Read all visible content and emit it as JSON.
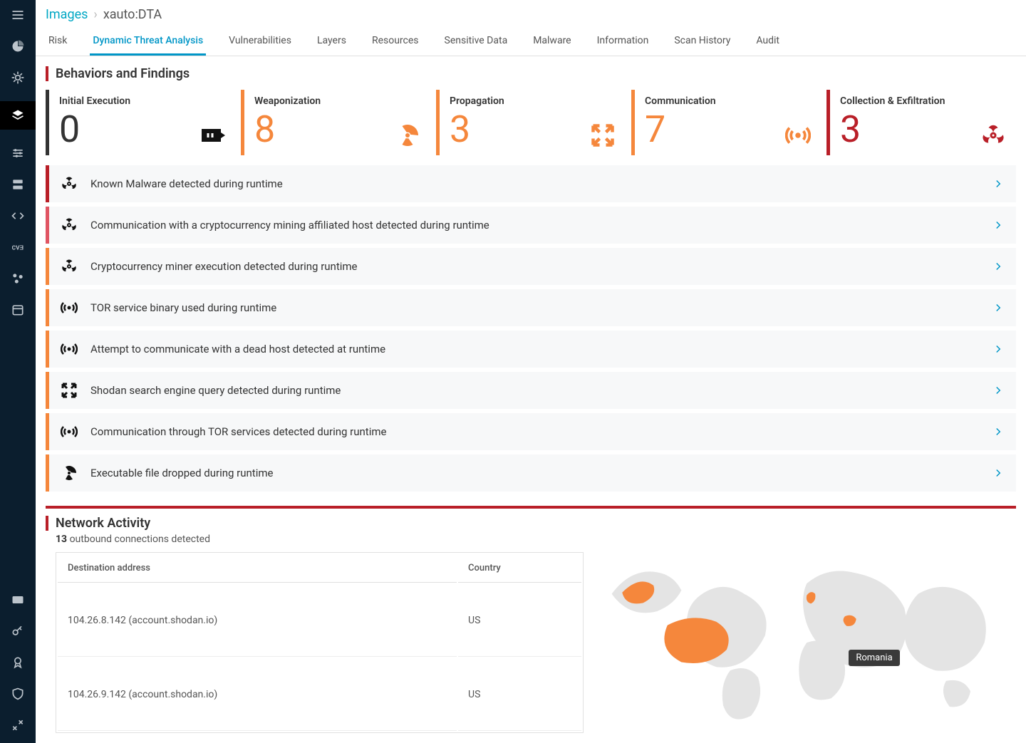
{
  "breadcrumb": {
    "root": "Images",
    "current": "xauto:DTA"
  },
  "tabs": [
    {
      "label": "Risk",
      "active": false
    },
    {
      "label": "Dynamic Threat Analysis",
      "active": true
    },
    {
      "label": "Vulnerabilities",
      "active": false
    },
    {
      "label": "Layers",
      "active": false
    },
    {
      "label": "Resources",
      "active": false
    },
    {
      "label": "Sensitive Data",
      "active": false
    },
    {
      "label": "Malware",
      "active": false
    },
    {
      "label": "Information",
      "active": false
    },
    {
      "label": "Scan History",
      "active": false
    },
    {
      "label": "Audit",
      "active": false
    }
  ],
  "section_title": "Behaviors and Findings",
  "metrics": [
    {
      "label": "Initial Execution",
      "value": "0",
      "color": "init",
      "icon": "execute"
    },
    {
      "label": "Weaponization",
      "value": "8",
      "color": "orange",
      "icon": "radiation"
    },
    {
      "label": "Propagation",
      "value": "3",
      "color": "orange",
      "icon": "expand"
    },
    {
      "label": "Communication",
      "value": "7",
      "color": "orange",
      "icon": "broadcast"
    },
    {
      "label": "Collection & Exfiltration",
      "value": "3",
      "color": "red",
      "icon": "biohazard"
    }
  ],
  "findings": [
    {
      "severity": "red",
      "icon": "biohazard",
      "text": "Known Malware detected during runtime"
    },
    {
      "severity": "lightred",
      "icon": "biohazard",
      "text": "Communication with a cryptocurrency mining affiliated host detected during runtime"
    },
    {
      "severity": "orange",
      "icon": "biohazard",
      "text": "Cryptocurrency miner execution detected during runtime"
    },
    {
      "severity": "orange",
      "icon": "broadcast",
      "text": "TOR service binary used during runtime"
    },
    {
      "severity": "orange",
      "icon": "broadcast",
      "text": "Attempt to communicate with a dead host detected at runtime"
    },
    {
      "severity": "orange",
      "icon": "expand",
      "text": "Shodan search engine query detected during runtime"
    },
    {
      "severity": "orange",
      "icon": "broadcast",
      "text": "Communication through TOR services detected during runtime"
    },
    {
      "severity": "orange",
      "icon": "radiation",
      "text": "Executable file dropped during runtime"
    }
  ],
  "network": {
    "title": "Network Activity",
    "count": "13",
    "subtext": "outbound connections detected",
    "columns": [
      "Destination address",
      "Country"
    ],
    "rows": [
      {
        "addr": "104.26.8.142 (account.shodan.io)",
        "country": "US"
      },
      {
        "addr": "104.26.9.142 (account.shodan.io)",
        "country": "US"
      }
    ],
    "tooltip": "Romania"
  }
}
